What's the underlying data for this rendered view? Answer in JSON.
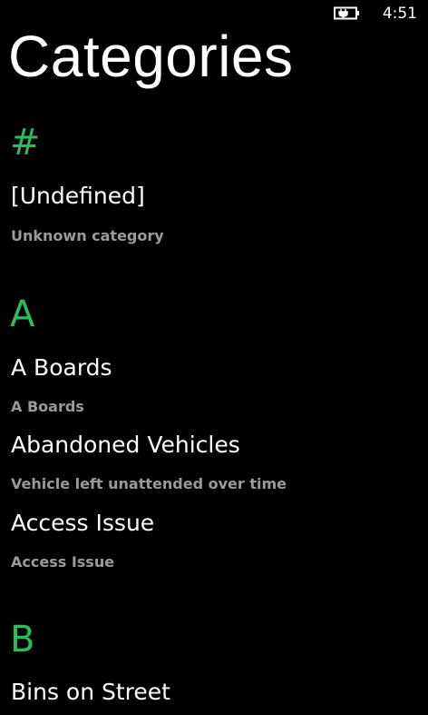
{
  "status_bar": {
    "battery_icon": "battery-charging-icon",
    "time": "4:51"
  },
  "page": {
    "title": "Categories"
  },
  "groups": [
    {
      "letter": "#",
      "items": [
        {
          "name": "[Undefined]",
          "description": "Unknown category"
        }
      ]
    },
    {
      "letter": "A",
      "items": [
        {
          "name": "A Boards",
          "description": "A Boards"
        },
        {
          "name": "Abandoned Vehicles",
          "description": "Vehicle left unattended over time"
        },
        {
          "name": "Access Issue",
          "description": "Access Issue"
        }
      ]
    },
    {
      "letter": "B",
      "items": [
        {
          "name": "Bins on Street"
        }
      ]
    }
  ],
  "colors": {
    "background": "#000000",
    "accent": "#2dbb5f",
    "primary_text": "#ffffff",
    "secondary_text": "#9a9a9a"
  }
}
